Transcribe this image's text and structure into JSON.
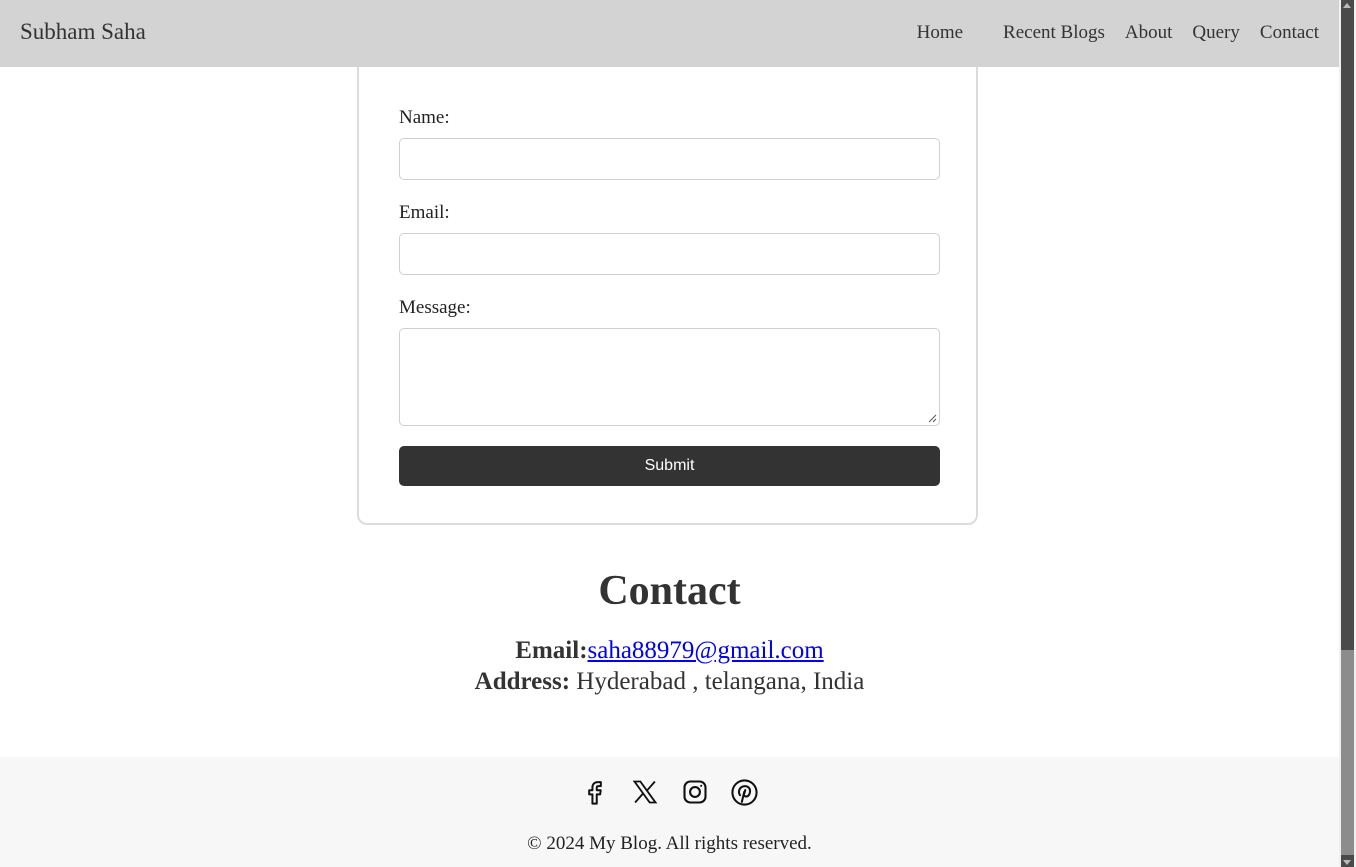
{
  "header": {
    "brand": "Subham Saha",
    "nav": [
      "Home",
      "Recent Blogs",
      "About",
      "Query",
      "Contact"
    ]
  },
  "form": {
    "name_label": "Name:",
    "name_value": "",
    "email_label": "Email:",
    "email_value": "",
    "message_label": "Message:",
    "message_value": "",
    "submit_label": "Submit"
  },
  "contact": {
    "title": "Contact",
    "email_label": "Email:",
    "email": "saha88979@gmail.com",
    "address_label": "Address:",
    "address": " Hyderabad , telangana, India"
  },
  "footer": {
    "socials": [
      "facebook-icon",
      "x-icon",
      "instagram-icon",
      "pinterest-icon"
    ],
    "copyright": "© 2024 My Blog. All rights reserved."
  },
  "colors": {
    "header_bg": "#d3d3d3",
    "button_bg": "#333333",
    "link": "#0000ee",
    "footer_bg": "#f7f7f7"
  }
}
